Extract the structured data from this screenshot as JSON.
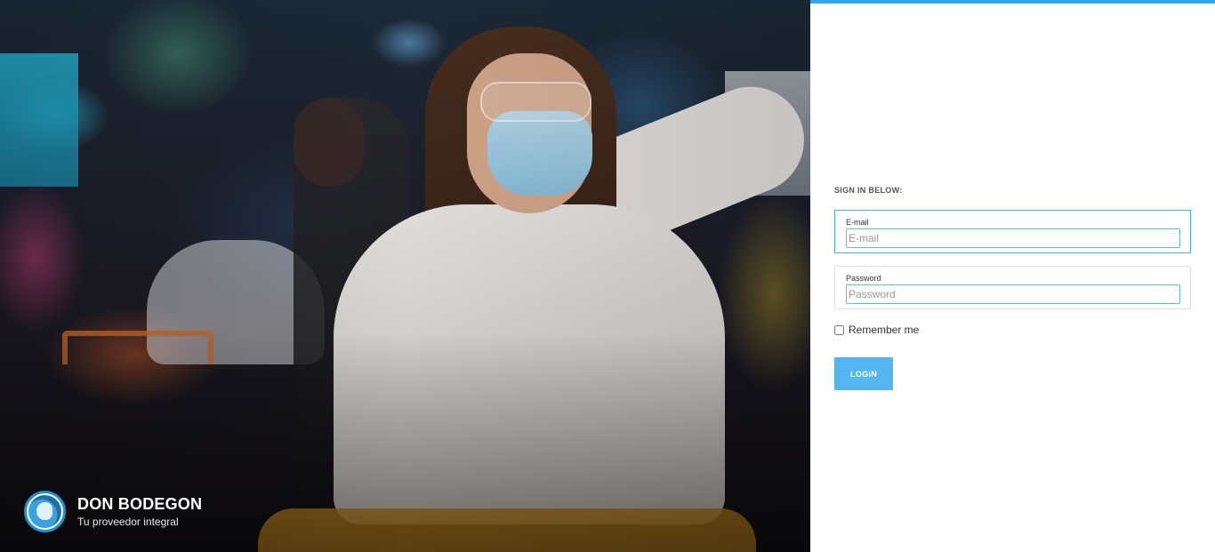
{
  "brand": {
    "name": "DON BODEGON",
    "tagline": "Tu proveedor integral"
  },
  "login": {
    "title": "SIGN IN BELOW:",
    "email": {
      "label": "E-mail",
      "placeholder": "E-mail",
      "value": ""
    },
    "password": {
      "label": "Password",
      "placeholder": "Password",
      "value": ""
    },
    "remember_label": "Remember me",
    "remember_checked": false,
    "button_label": "LOGIN"
  },
  "colors": {
    "accent": "#2ea7ee",
    "button": "#55b6ef",
    "focus_border": "#4fa9e3"
  }
}
